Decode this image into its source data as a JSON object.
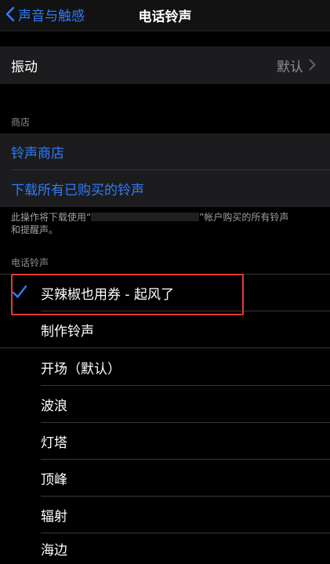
{
  "nav": {
    "back_label": "声音与触感",
    "title": "电话铃声"
  },
  "vibration": {
    "label": "振动",
    "value": "默认"
  },
  "store_section": {
    "header": "商店",
    "tone_store": "铃声商店",
    "download_all": "下载所有已购买的铃声",
    "footnote_before": "此操作将下载使用“",
    "footnote_after": "”帐户购买的所有铃声",
    "footnote_line2": "和提醒声。"
  },
  "ringtones_section": {
    "header": "电话铃声",
    "selected": "买辣椒也用券 - 起风了",
    "create": "制作铃声",
    "items": [
      "开场（默认）",
      "波浪",
      "灯塔",
      "顶峰",
      "辐射",
      "海边"
    ]
  },
  "colors": {
    "accent": "#2f7cf6",
    "highlight": "#e53935"
  }
}
